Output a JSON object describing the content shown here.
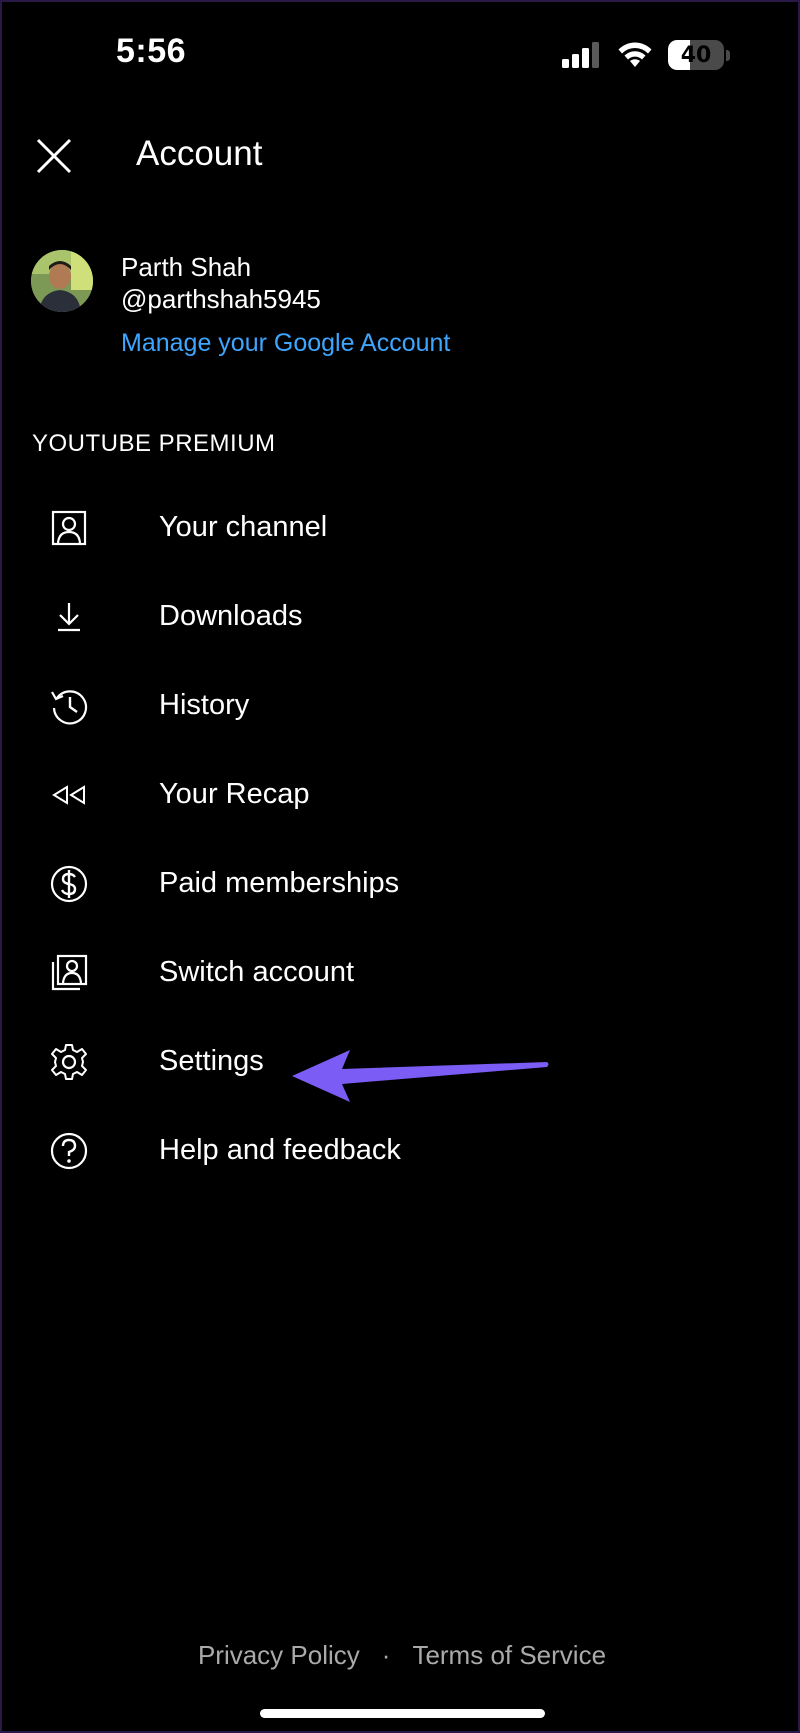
{
  "status_bar": {
    "time": "5:56",
    "battery_level": 40,
    "battery_label": "40"
  },
  "header": {
    "title": "Account",
    "close_icon": "close-icon"
  },
  "profile": {
    "name": "Parth Shah",
    "handle": "@parthshah5945",
    "manage_link": "Manage your Google Account"
  },
  "section": {
    "heading": "YOUTUBE PREMIUM"
  },
  "menu": {
    "items": [
      {
        "label": "Your channel",
        "icon": "person-box-icon"
      },
      {
        "label": "Downloads",
        "icon": "download-icon"
      },
      {
        "label": "History",
        "icon": "history-icon"
      },
      {
        "label": "Your Recap",
        "icon": "rewind-icon"
      },
      {
        "label": "Paid memberships",
        "icon": "dollar-icon"
      },
      {
        "label": "Switch account",
        "icon": "switch-account-icon"
      },
      {
        "label": "Settings",
        "icon": "gear-icon"
      },
      {
        "label": "Help and feedback",
        "icon": "help-icon"
      }
    ]
  },
  "footer": {
    "privacy": "Privacy Policy",
    "separator": "·",
    "terms": "Terms of Service"
  },
  "colors": {
    "background": "#000000",
    "link": "#3ea6ff",
    "annotation_arrow": "#7b5cf5",
    "footer_text": "#aaaaaa"
  }
}
